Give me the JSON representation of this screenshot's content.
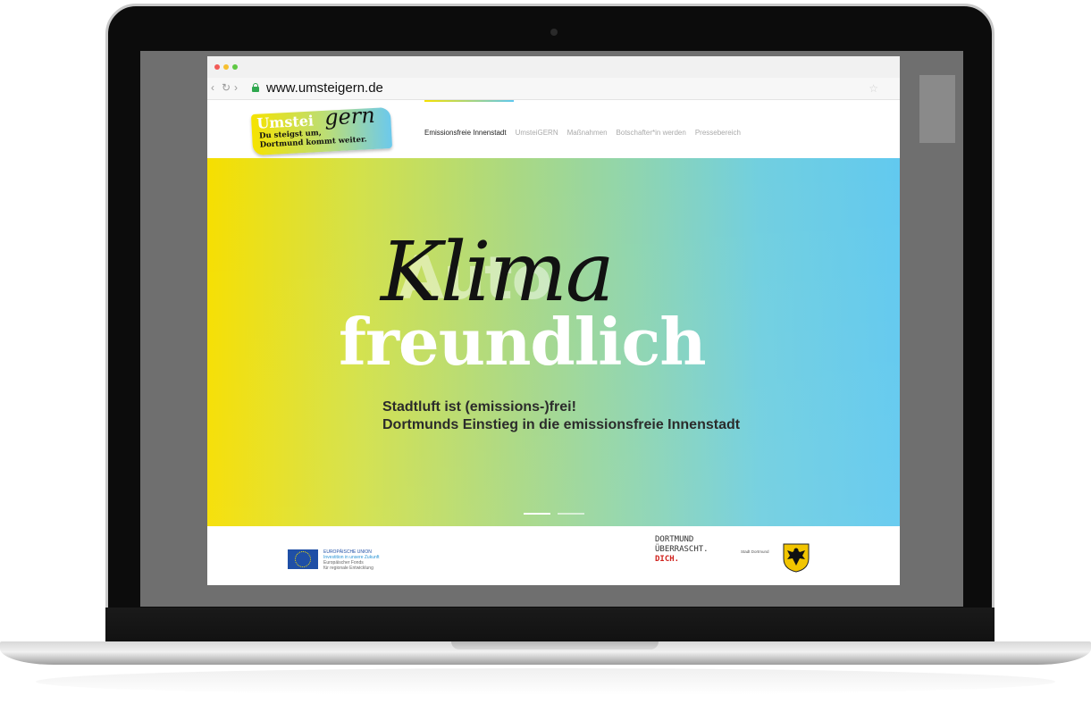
{
  "browser": {
    "url": "www.umsteigern.de"
  },
  "site": {
    "logo": {
      "word_main": "Umstei",
      "word_script": "gern",
      "tagline_line1": "Du steigst um,",
      "tagline_line2": "Dortmund kommt weiter."
    },
    "nav": [
      {
        "label": "Emissionsfreie Innenstadt",
        "active": true
      },
      {
        "label": "UmsteiGERN",
        "active": false
      },
      {
        "label": "Maßnahmen",
        "active": false
      },
      {
        "label": "Botschafter*in werden",
        "active": false
      },
      {
        "label": "Pressebereich",
        "active": false
      }
    ],
    "hero": {
      "ghost_word": "Auto",
      "script_word": "Klima",
      "big_word": "freundlich",
      "subtitle_line1": "Stadtluft ist (emissions-)frei!",
      "subtitle_line2": "Dortmunds Einstieg in die emissionsfreie Innenstadt",
      "slides": 2,
      "active_slide": 1
    },
    "footer": {
      "eu_title": "EUROPÄISCHE UNION",
      "eu_line2": "Investition in unsere Zukunft",
      "eu_line3": "Europäischer Fonds",
      "eu_line4": "für regionale Entwicklung",
      "dortmund_line1": "DORTMUND",
      "dortmund_line2": "ÜBERRASCHT.",
      "dortmund_line3": "DICH.",
      "stadt_label": "Stadt Dortmund"
    }
  },
  "colors": {
    "gradient_start": "#f6df00",
    "gradient_end": "#62c9ef",
    "eu_blue": "#1f4fa6",
    "dortmund_red": "#d0231e"
  }
}
